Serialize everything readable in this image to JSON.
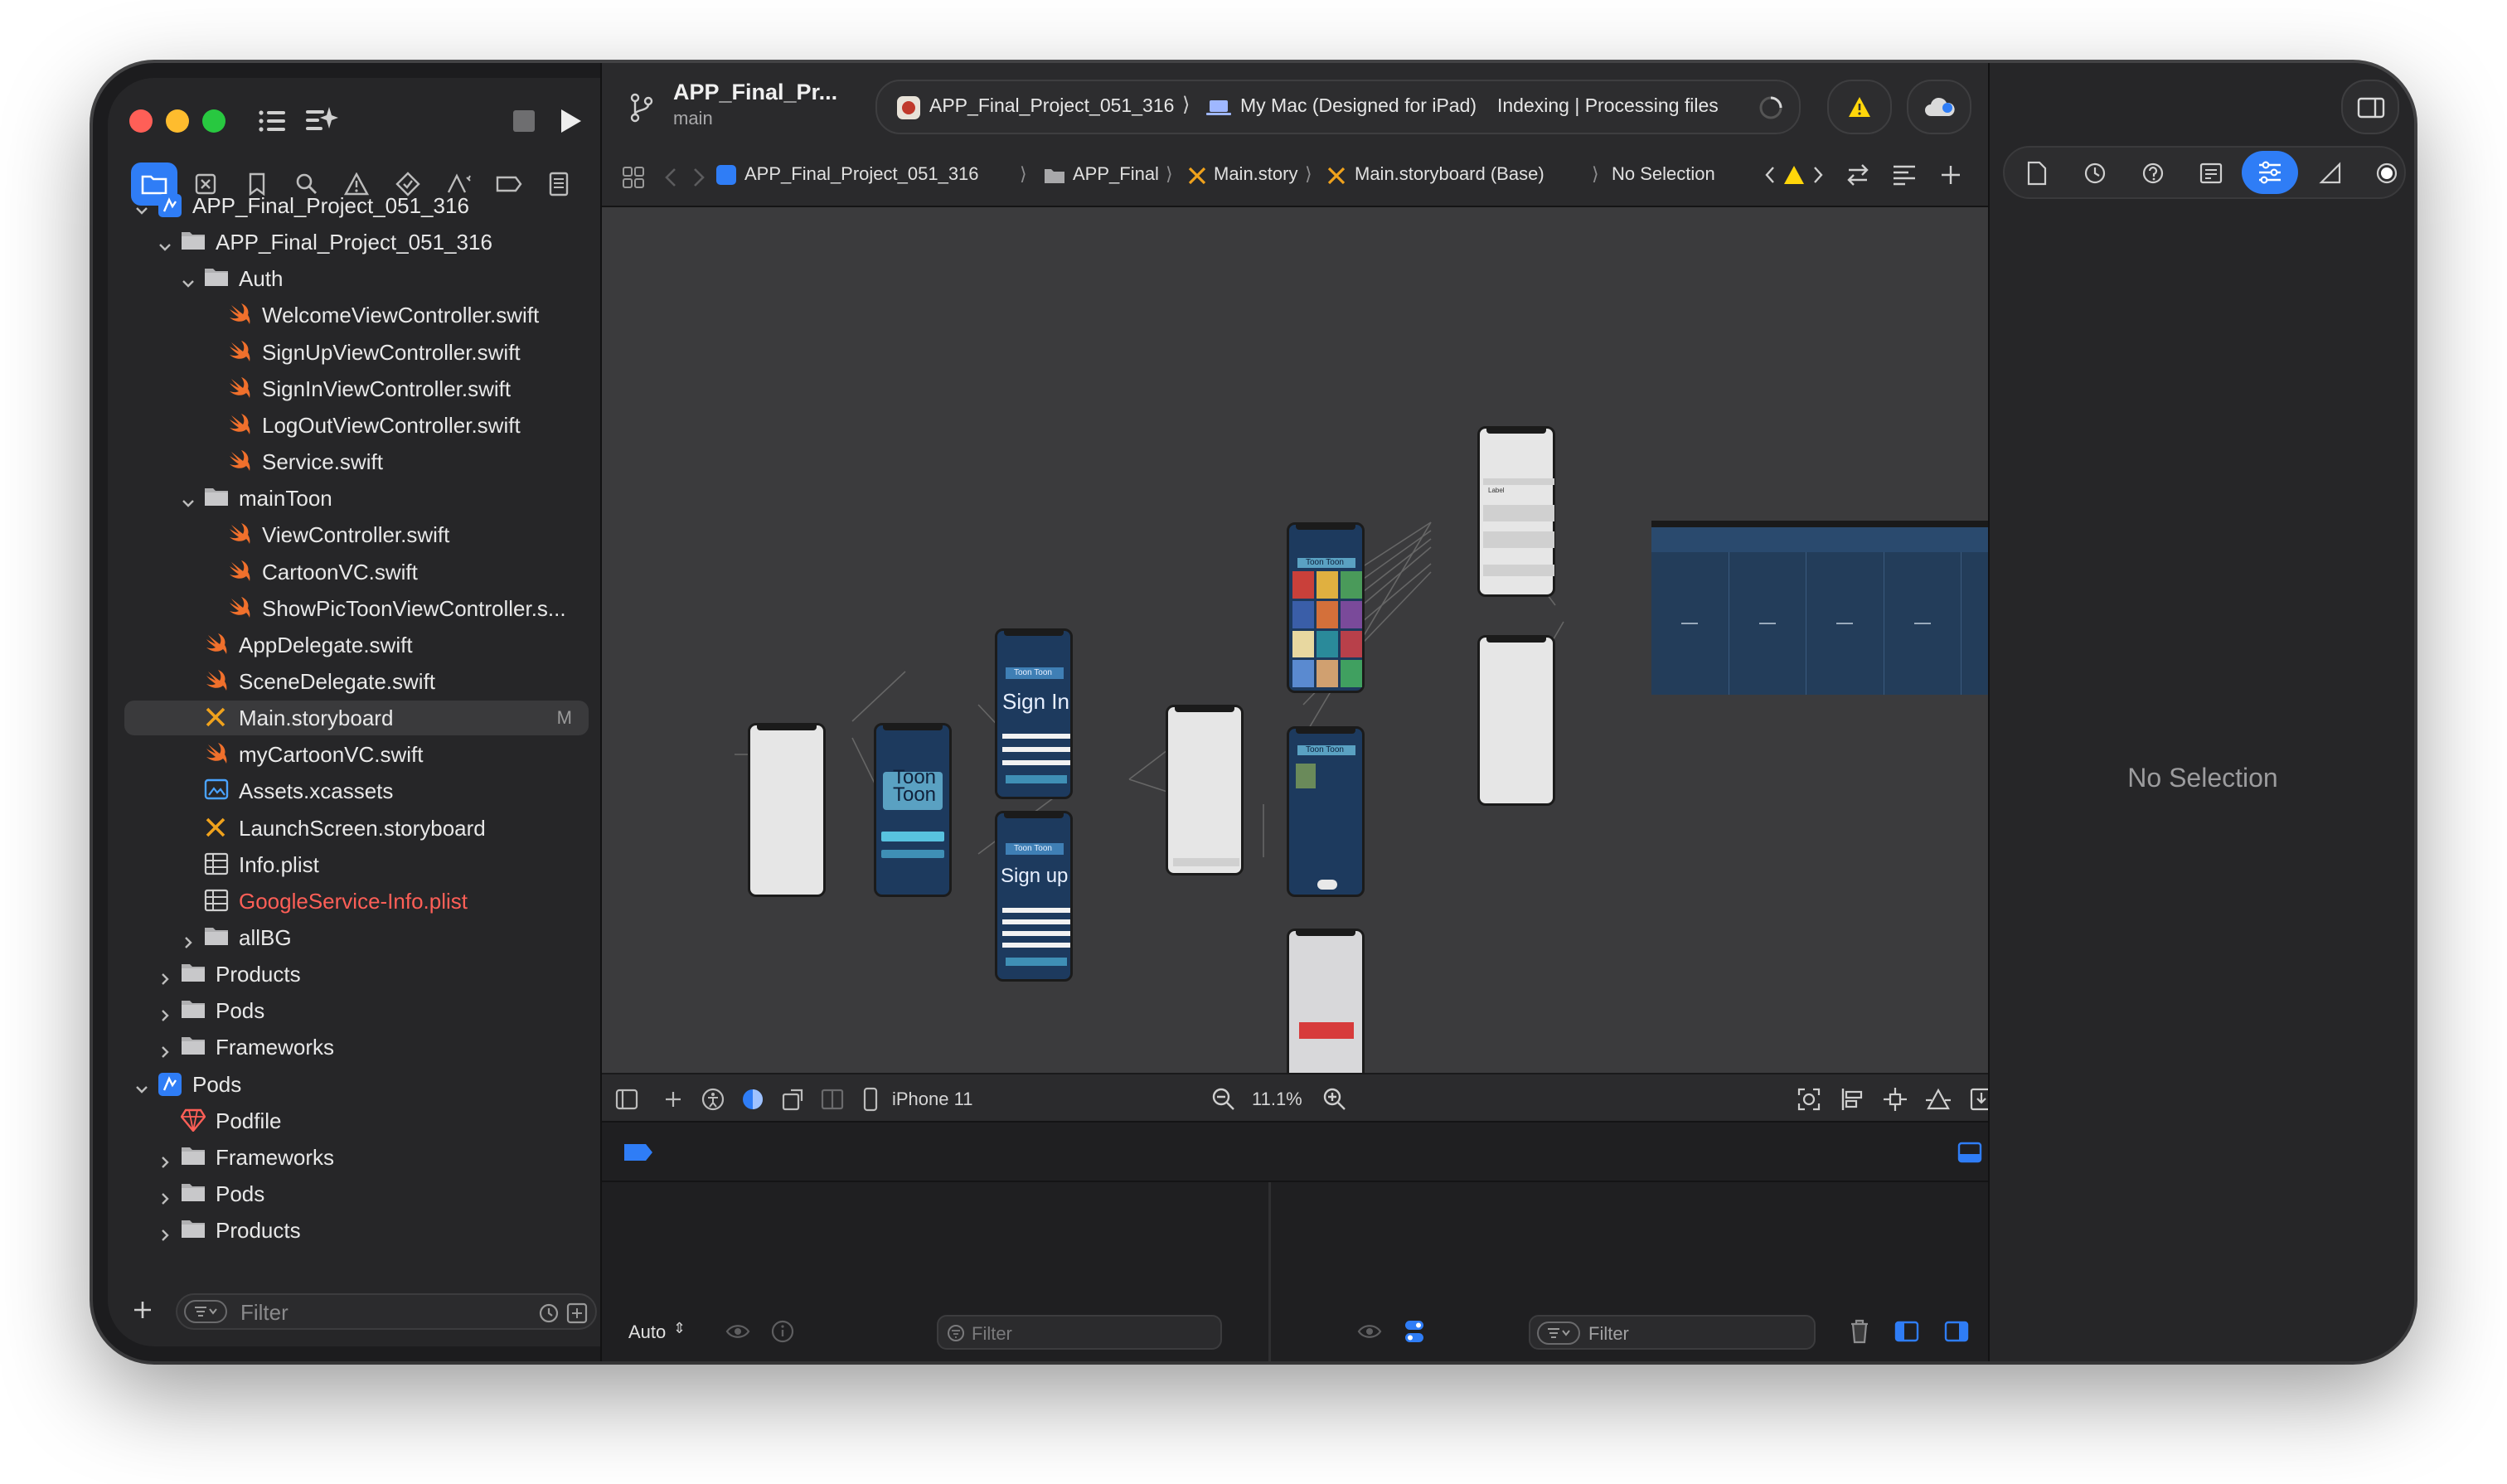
{
  "toolbar": {
    "scheme_title": "APP_Final_Pr...",
    "branch": "main",
    "target_app": "APP_Final_Project_051_316",
    "destination": "My Mac (Designed for iPad)",
    "activity_status": "Indexing | Processing files"
  },
  "jumpbar": {
    "crumbs": [
      "APP_Final_Project_051_316",
      "APP_Final",
      "Main.story",
      "Main.storyboard (Base)",
      "No Selection"
    ]
  },
  "navigator": {
    "items": [
      {
        "label": "APP_Final_Project_051_316",
        "icon": "project-icon",
        "expanded": true
      },
      {
        "label": "APP_Final_Project_051_316",
        "icon": "folder-icon",
        "expanded": true
      },
      {
        "label": "Auth",
        "icon": "folder-icon",
        "expanded": true
      },
      {
        "label": "WelcomeViewController.swift",
        "icon": "swift-file-icon"
      },
      {
        "label": "SignUpViewController.swift",
        "icon": "swift-file-icon"
      },
      {
        "label": "SignInViewController.swift",
        "icon": "swift-file-icon"
      },
      {
        "label": "LogOutViewController.swift",
        "icon": "swift-file-icon"
      },
      {
        "label": "Service.swift",
        "icon": "swift-file-icon"
      },
      {
        "label": "mainToon",
        "icon": "folder-icon",
        "expanded": true
      },
      {
        "label": "ViewController.swift",
        "icon": "swift-file-icon"
      },
      {
        "label": "CartoonVC.swift",
        "icon": "swift-file-icon"
      },
      {
        "label": "ShowPicToonViewController.s...",
        "icon": "swift-file-icon"
      },
      {
        "label": "AppDelegate.swift",
        "icon": "swift-file-icon"
      },
      {
        "label": "SceneDelegate.swift",
        "icon": "swift-file-icon"
      },
      {
        "label": "Main.storyboard",
        "icon": "storyboard-icon",
        "selected": true,
        "badge": "M"
      },
      {
        "label": "myCartoonVC.swift",
        "icon": "swift-file-icon"
      },
      {
        "label": "Assets.xcassets",
        "icon": "assets-icon"
      },
      {
        "label": "LaunchScreen.storyboard",
        "icon": "storyboard-icon"
      },
      {
        "label": "Info.plist",
        "icon": "plist-icon"
      },
      {
        "label": "GoogleService-Info.plist",
        "icon": "plist-icon",
        "missing": true
      },
      {
        "label": "allBG",
        "icon": "folder-icon",
        "expanded": false
      },
      {
        "label": "Products",
        "icon": "folder-icon",
        "expanded": false
      },
      {
        "label": "Pods",
        "icon": "folder-icon",
        "expanded": false
      },
      {
        "label": "Frameworks",
        "icon": "folder-icon",
        "expanded": false
      },
      {
        "label": "Pods",
        "icon": "project-icon",
        "expanded": true
      },
      {
        "label": "Podfile",
        "icon": "ruby-icon"
      },
      {
        "label": "Frameworks",
        "icon": "folder-icon",
        "expanded": false
      },
      {
        "label": "Pods",
        "icon": "folder-icon",
        "expanded": false
      },
      {
        "label": "Products",
        "icon": "folder-icon",
        "expanded": false
      }
    ],
    "filter_placeholder": "Filter"
  },
  "canvas": {
    "scenes": {
      "toon_title": "Toon\nToon",
      "sign_in_header": "Toon Toon",
      "sign_in_title": "Sign In",
      "sign_up_header": "Toon Toon",
      "sign_up_title": "Sign up",
      "grid_header": "Toon Toon",
      "list_header": "Toon Toon",
      "label_text": "Label"
    },
    "device": "iPhone 11",
    "zoom": "11.1%"
  },
  "debug": {
    "auto_label": "Auto",
    "filter_left": "Filter",
    "filter_right": "Filter"
  },
  "inspector": {
    "empty_state": "No Selection"
  },
  "colors": {
    "accent": "#2f7df6",
    "window_bg": "#1c1c1e",
    "canvas_bg": "#3b3b3d",
    "swift_orange": "#f0702c",
    "missing_red": "#ff5f57",
    "toon_blue": "#1d3a5e"
  }
}
